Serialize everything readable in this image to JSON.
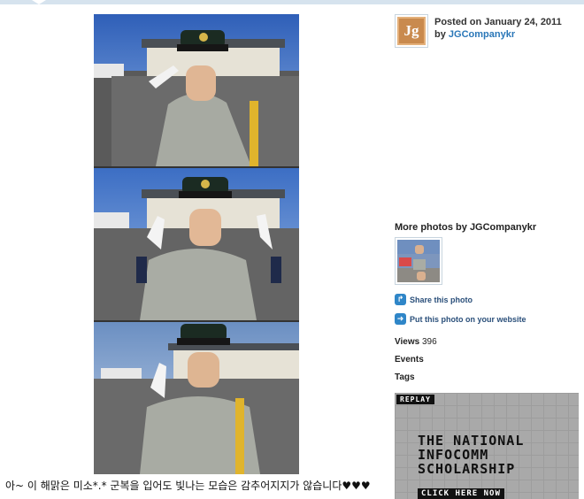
{
  "photo": {
    "alt": "Cadet in grey uniform giving V sign in front of a building",
    "caption": "아~ 이 해맑은 미소*.* 군복을 입어도 빛나는 모습은 감추어지지가 않습니다♥♥♥"
  },
  "sidebar": {
    "avatar_text": "Jg",
    "posted_label": "Posted on January 24, 2011",
    "by_prefix": "by",
    "author": "JGCompanykr",
    "more_photos_title": "More photos by JGCompanykr",
    "share_label": "Share this photo",
    "embed_label": "Put this photo on your website",
    "views_label": "Views",
    "views_count": "396",
    "events_label": "Events",
    "tags_label": "Tags"
  },
  "ad": {
    "badge": "REPLAY",
    "title_line1": "THE NATIONAL",
    "title_line2": "INFOCOMM",
    "title_line3": "SCHOLARSHIP",
    "cta": "CLICK HERE NOW"
  },
  "colors": {
    "link": "#2a77b8",
    "action_icon": "#2f86c8",
    "topbar": "#d6e3ee"
  },
  "icons": {
    "share": "share-arrow-icon",
    "embed": "embed-arrow-icon"
  }
}
